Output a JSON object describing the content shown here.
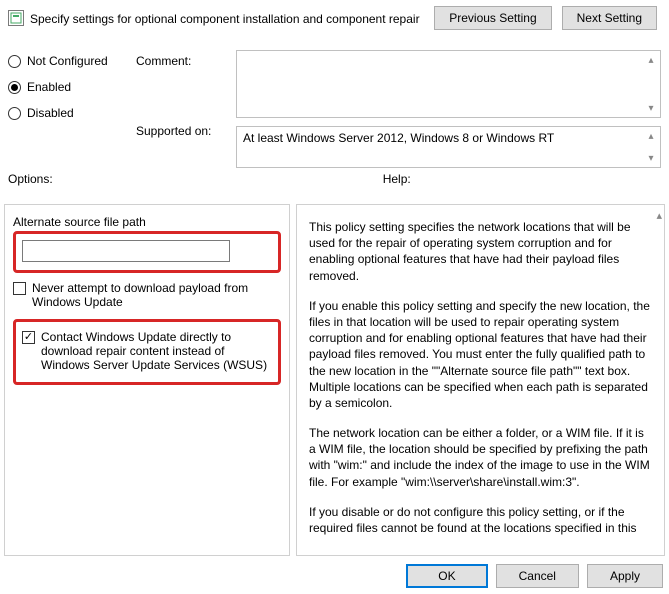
{
  "title": "Specify settings for optional component installation and component repair",
  "nav": {
    "prev": "Previous Setting",
    "next": "Next Setting"
  },
  "state": {
    "not_configured": "Not Configured",
    "enabled": "Enabled",
    "disabled": "Disabled",
    "selected": "enabled"
  },
  "labels": {
    "comment": "Comment:",
    "supported": "Supported on:",
    "options": "Options:",
    "help": "Help:"
  },
  "supported_text": "At least Windows Server 2012, Windows 8 or Windows RT",
  "options": {
    "alt_path_label": "Alternate source file path",
    "alt_path_value": "",
    "never_download": "Never attempt to download payload from Windows Update",
    "contact_wu": "Contact Windows Update directly to download repair content instead of Windows Server Update Services (WSUS)"
  },
  "help_paragraphs": [
    "This policy setting specifies the network locations that will be used for the repair of operating system corruption and for enabling optional features that have had their payload files removed.",
    "If you enable this policy setting and specify the new location, the files in that location will be used to repair operating system corruption and for enabling optional features that have had their payload files removed. You must enter the fully qualified path to the new location in the \"\"Alternate source file path\"\" text box. Multiple locations can be specified when each path is separated by a semicolon.",
    "The network location can be either a folder, or a WIM file. If it is a WIM file, the location should be specified by prefixing the path with \"wim:\" and include the index of the image to use in the WIM file. For example \"wim:\\\\server\\share\\install.wim:3\".",
    "If you disable or do not configure this policy setting, or if the required files cannot be found at the locations specified in this"
  ],
  "footer": {
    "ok": "OK",
    "cancel": "Cancel",
    "apply": "Apply"
  }
}
